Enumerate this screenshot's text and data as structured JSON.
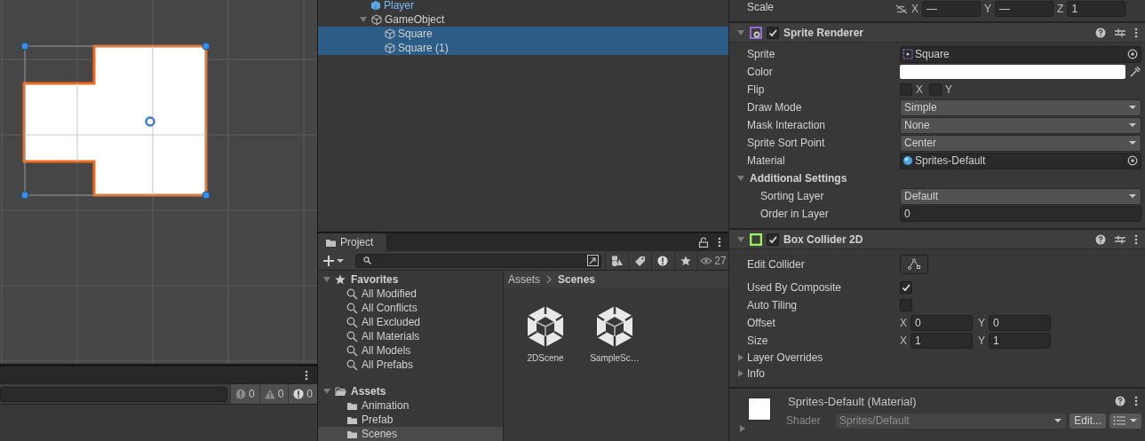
{
  "scene": {
    "console": {
      "counts": [
        {
          "kind": "info",
          "value": "0"
        },
        {
          "kind": "warning",
          "value": "0"
        },
        {
          "kind": "error",
          "value": "0"
        }
      ]
    }
  },
  "hierarchy": {
    "items": [
      {
        "label": "Player",
        "kind": "prefab",
        "selected": false
      },
      {
        "label": "GameObject",
        "kind": "object",
        "selected": false,
        "expanded": true,
        "children": [
          {
            "label": "Square",
            "kind": "object",
            "selected": true
          },
          {
            "label": "Square (1)",
            "kind": "object",
            "selected": true
          }
        ]
      }
    ]
  },
  "project": {
    "tab": "Project",
    "hidden_count": "27",
    "favorites": {
      "label": "Favorites",
      "expanded": true,
      "items": [
        "All Modified",
        "All Conflicts",
        "All Excluded",
        "All Materials",
        "All Models",
        "All Prefabs"
      ]
    },
    "assets": {
      "label": "Assets",
      "expanded": true,
      "children": [
        {
          "label": "Animation",
          "selected": false
        },
        {
          "label": "Prefab",
          "selected": false
        },
        {
          "label": "Scenes",
          "selected": true
        }
      ]
    },
    "breadcrumb": [
      "Assets",
      "Scenes"
    ],
    "files": [
      {
        "name": "2DScene"
      },
      {
        "name": "SampleSc…"
      }
    ]
  },
  "inspector": {
    "scale": {
      "label": "Scale",
      "fields": [
        {
          "axis": "X",
          "value": "—"
        },
        {
          "axis": "Y",
          "value": "—"
        },
        {
          "axis": "Z",
          "value": "1"
        }
      ]
    },
    "components": [
      {
        "title": "Sprite Renderer",
        "kind": "sprite",
        "enabled": true,
        "expanded": true,
        "rows": [
          {
            "kind": "spritefield",
            "label": "Sprite",
            "value": "Square"
          },
          {
            "kind": "color",
            "label": "Color",
            "color": "#ffffff"
          },
          {
            "kind": "flip",
            "label": "Flip",
            "x": {
              "label": "X",
              "checked": false
            },
            "y": {
              "label": "Y",
              "checked": false
            }
          },
          {
            "kind": "dropdown",
            "label": "Draw Mode",
            "value": "Simple"
          },
          {
            "kind": "dropdown",
            "label": "Mask Interaction",
            "value": "None"
          },
          {
            "kind": "dropdown",
            "label": "Sprite Sort Point",
            "value": "Center"
          },
          {
            "kind": "materialfield",
            "label": "Material",
            "value": "Sprites-Default"
          },
          {
            "kind": "section",
            "label": "Additional Settings",
            "expanded": true
          },
          {
            "kind": "dropdown",
            "label": "Sorting Layer",
            "value": "Default",
            "indent": true
          },
          {
            "kind": "field",
            "label": "Order in Layer",
            "value": "0",
            "indent": true
          }
        ]
      },
      {
        "title": "Box Collider 2D",
        "kind": "collider",
        "enabled": true,
        "expanded": true,
        "rows": [
          {
            "kind": "button",
            "label": "Edit Collider"
          },
          {
            "kind": "checkbox",
            "label": "Used By Composite",
            "checked": true
          },
          {
            "kind": "checkbox",
            "label": "Auto Tiling",
            "checked": false
          },
          {
            "kind": "vector2",
            "label": "Offset",
            "x": {
              "label": "X",
              "value": "0"
            },
            "y": {
              "label": "Y",
              "value": "0"
            }
          },
          {
            "kind": "vector2",
            "label": "Size",
            "x": {
              "label": "X",
              "value": "1"
            },
            "y": {
              "label": "Y",
              "value": "1"
            }
          },
          {
            "kind": "foldout",
            "label": "Layer Overrides",
            "expanded": false
          },
          {
            "kind": "foldout",
            "label": "Info",
            "expanded": false
          }
        ]
      }
    ],
    "material": {
      "title": "Sprites-Default (Material)",
      "shader_label": "Shader",
      "shader": "Sprites/Default",
      "edit": "Edit...",
      "expanded": false
    }
  }
}
